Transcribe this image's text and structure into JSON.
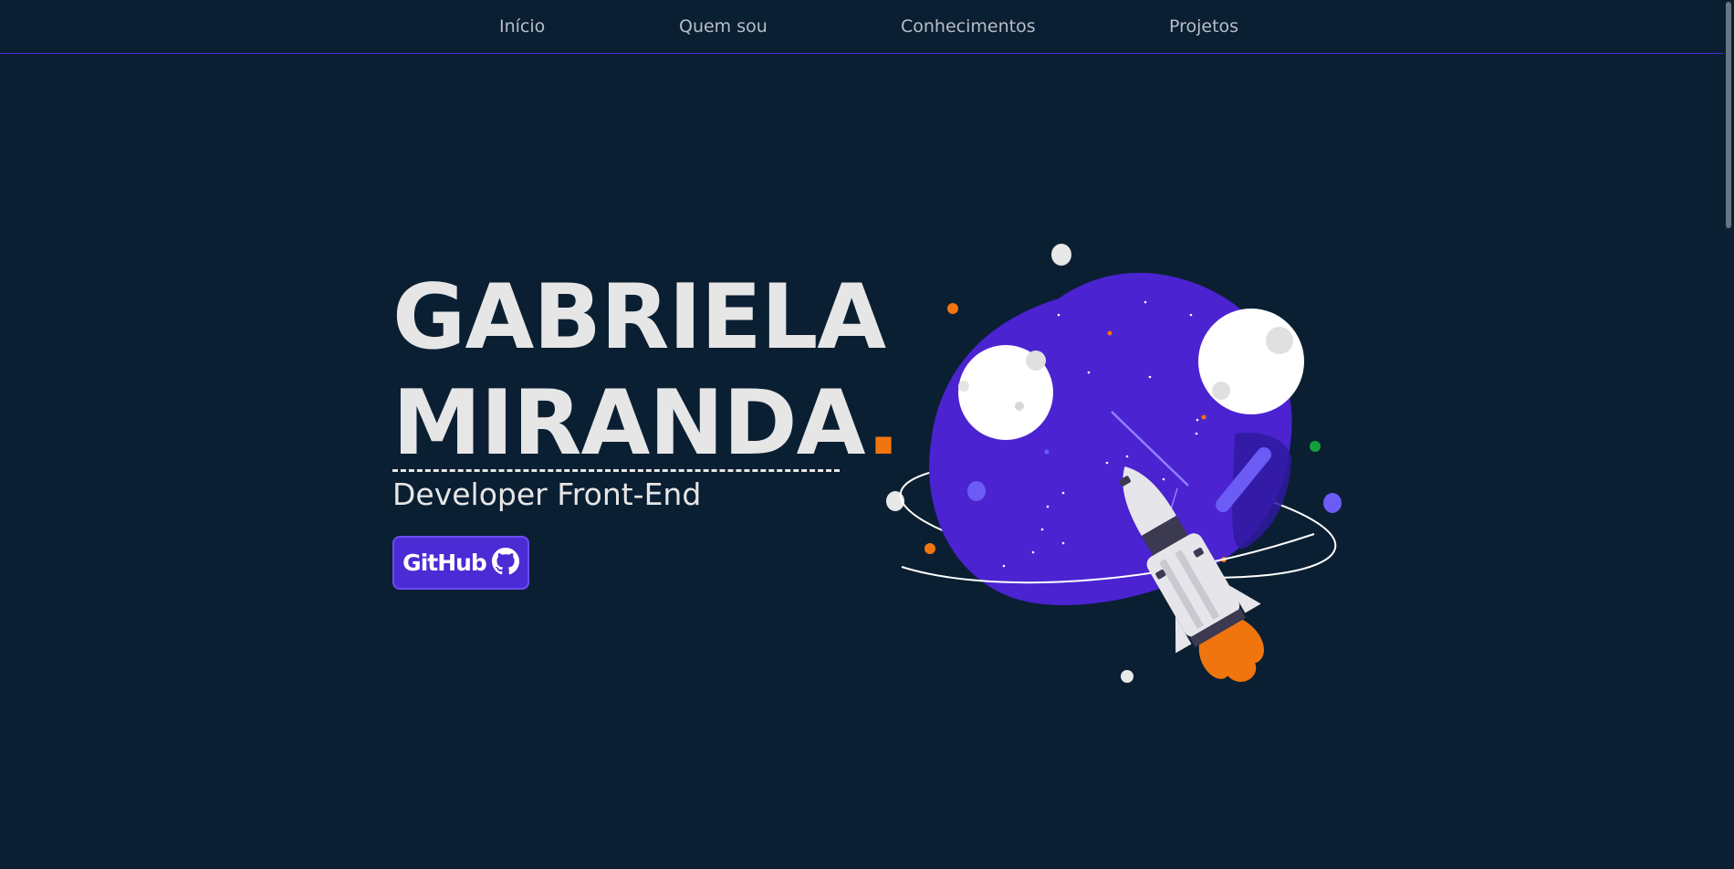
{
  "nav": {
    "items": [
      {
        "label": "Início"
      },
      {
        "label": "Quem sou"
      },
      {
        "label": "Conhecimentos"
      },
      {
        "label": "Projetos"
      }
    ]
  },
  "hero": {
    "first_name": "GABRIELA",
    "last_name": "MIRANDA",
    "accent_dot": ".",
    "role": "Developer Front-End",
    "github_label": "GitHub"
  },
  "colors": {
    "background": "#0b1f33",
    "accent": "#4b2bd4",
    "orange": "#f0750f",
    "text": "#e6e6e6"
  },
  "illustration": {
    "subject": "planet-with-rocket",
    "icons": [
      "github-icon"
    ]
  }
}
